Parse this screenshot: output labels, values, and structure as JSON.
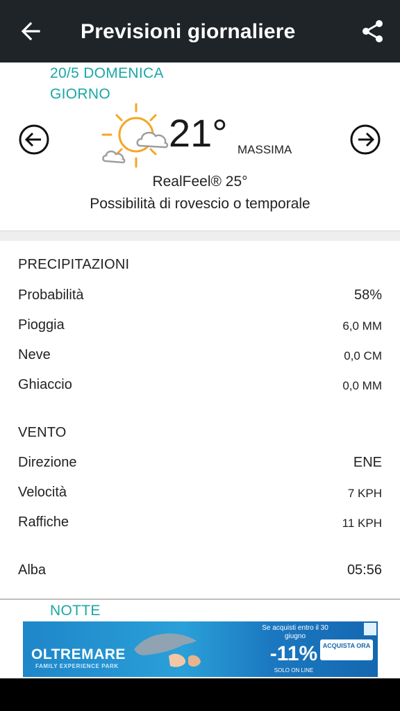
{
  "appbar": {
    "title": "Previsioni giornaliere",
    "back_icon": "arrow-left-icon",
    "share_icon": "share-icon"
  },
  "day": {
    "date": "20/5 DOMENICA",
    "period": "GIORNO",
    "weather_icon": "partly-sunny-showers-icon",
    "temperature": "21°",
    "temperature_label": "MASSIMA",
    "realfeel": "RealFeel® 25°",
    "phrase": "Possibilità di rovescio o temporale"
  },
  "precipitation": {
    "title": "PRECIPITAZIONI",
    "rows": [
      {
        "label": "Probabilità",
        "value": "58%"
      },
      {
        "label": "Pioggia",
        "value": "6,0 MM"
      },
      {
        "label": "Neve",
        "value": "0,0 CM"
      },
      {
        "label": "Ghiaccio",
        "value": "0,0 MM"
      }
    ]
  },
  "wind": {
    "title": "VENTO",
    "rows": [
      {
        "label": "Direzione",
        "value": "ENE"
      },
      {
        "label": "Velocità",
        "value": "7 KPH"
      },
      {
        "label": "Raffiche",
        "value": "11 KPH"
      }
    ]
  },
  "sun": {
    "label": "Alba",
    "value": "05:56"
  },
  "night": {
    "label": "NOTTE"
  },
  "ad": {
    "brand": "OLTREMARE",
    "brand_sub": "FAMILY EXPERIENCE PARK",
    "promo_line": "Se acquisti entro il 30 giugno",
    "discount": "-11%",
    "promo_sub": "SOLO ON LINE",
    "cta": "ACQUISTA ORA"
  },
  "colors": {
    "appbar_bg": "#1e2428",
    "accent_teal": "#1aa6a6",
    "sun_orange": "#f5a623"
  }
}
